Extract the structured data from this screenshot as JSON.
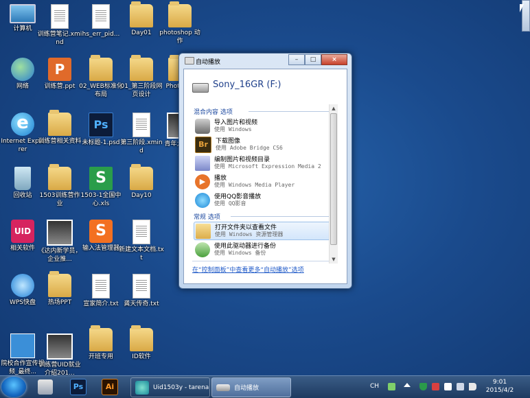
{
  "desktop": {
    "icons": [
      {
        "label": "计算机"
      },
      {
        "label": "训练营笔记.xmind"
      },
      {
        "label": "hs_err_pid..."
      },
      {
        "label": "Day01"
      },
      {
        "label": "photoshop 动作"
      },
      {
        "label": "网络"
      },
      {
        "label": "训练营.ppt"
      },
      {
        "label": "02_WEB标准化布局"
      },
      {
        "label": "01_第三阶段网页设计"
      },
      {
        "label": "Phot 抽出"
      },
      {
        "label": "Internet Explorer"
      },
      {
        "label": "训练营相关资料"
      },
      {
        "label": "未标题-1.psd"
      },
      {
        "label": "第三阶段.xmind"
      },
      {
        "label": "青年大城市"
      },
      {
        "label": "回收站"
      },
      {
        "label": "1503训练营作业"
      },
      {
        "label": "1503-1全国中心.xls"
      },
      {
        "label": "Day10"
      },
      {
        "label": "相关软件"
      },
      {
        "label": "《达内新学员，企业推..."
      },
      {
        "label": "输入法管理器"
      },
      {
        "label": "新建文本文档.txt"
      },
      {
        "label": "WPS快盘"
      },
      {
        "label": "热场PPT"
      },
      {
        "label": "宣家简介.txt"
      },
      {
        "label": "龚天传奇.txt"
      },
      {
        "label": "院校合作宣传视频_最终..."
      },
      {
        "label": "训练营UID就业介绍201..."
      },
      {
        "label": "开班专用"
      },
      {
        "label": "ID软件"
      }
    ]
  },
  "autoplay": {
    "title": "自动播放",
    "device": "Sony_16GR (F:)",
    "section_mixed": "混合内容 选项",
    "section_general": "常规 选项",
    "items": [
      {
        "main": "导入图片和视频",
        "sub": "使用 Windows"
      },
      {
        "main": "下载图像",
        "sub": "使用 Adobe Bridge CS6"
      },
      {
        "main": "编制图片和视频目录",
        "sub": "使用 Microsoft Expression Media 2"
      },
      {
        "main": "播放",
        "sub": "使用 Windows Media Player"
      },
      {
        "main": "使用QQ影音播放",
        "sub": "使用 QQ影音"
      }
    ],
    "general_items": [
      {
        "main": "打开文件夹以查看文件",
        "sub": "使用 Windows 资源管理器"
      },
      {
        "main": "使用此驱动器进行备份",
        "sub": "使用 Windows 备份"
      }
    ],
    "control_panel_link": "在“控制面板”中查看更多“自动播放”选项",
    "minimize": "–",
    "maximize": "□",
    "close": "×"
  },
  "taskbar": {
    "pinned": [
      {
        "name": "calculator",
        "label": ""
      },
      {
        "name": "photoshop",
        "label": "Ps"
      },
      {
        "name": "illustrator",
        "label": "Ai"
      }
    ],
    "tasks": [
      {
        "label": "Uid1503y - tarena"
      },
      {
        "label": "自动播放"
      }
    ],
    "lang": "CH",
    "time": "9:01",
    "date": "2015/4/2"
  },
  "colors": {
    "desktop_bg": "#1b4c8f",
    "link": "#1f5ac8",
    "section_head": "#1e4aa0"
  }
}
